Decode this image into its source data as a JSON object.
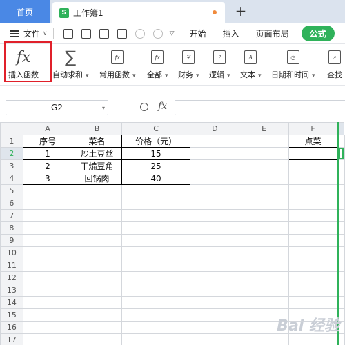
{
  "tabs": {
    "home": "首页",
    "doc": "工作簿1",
    "doc_icon": "S",
    "new_tab": "+"
  },
  "menu": {
    "file": "文件",
    "items": [
      "开始",
      "插入",
      "页面布局"
    ],
    "active": "公式"
  },
  "ribbon": {
    "insert_function": "插入函数",
    "insert_function_icon": "fx",
    "autosum": "自动求和",
    "autosum_icon": "∑",
    "common_functions": "常用函数",
    "all": "全部",
    "finance": "财务",
    "logic": "逻辑",
    "text": "文本",
    "datetime": "日期和时间",
    "lookup": "查找"
  },
  "formula_bar": {
    "name_box": "G2",
    "fx": "fx",
    "content": ""
  },
  "sheet": {
    "columns": [
      "A",
      "B",
      "C",
      "D",
      "E",
      "F"
    ],
    "rows": [
      "1",
      "2",
      "3",
      "4",
      "5",
      "6",
      "7",
      "8",
      "9",
      "10",
      "11",
      "12",
      "13",
      "14",
      "15",
      "16",
      "17"
    ],
    "cells": {
      "A1": "序号",
      "B1": "菜名",
      "C1": "价格（元）",
      "F1": "点菜",
      "A2": "1",
      "B2": "炒土豆丝",
      "C2": "15",
      "A3": "2",
      "B3": "干煸豆角",
      "C3": "25",
      "A4": "3",
      "B4": "回锅肉",
      "C4": "40"
    },
    "selected_row": "2",
    "active_cell": "G2"
  },
  "colors": {
    "accent": "#2fb25a",
    "home_tab": "#4a88e5",
    "highlight": "#e0202a"
  },
  "watermark": "Bai 经验"
}
